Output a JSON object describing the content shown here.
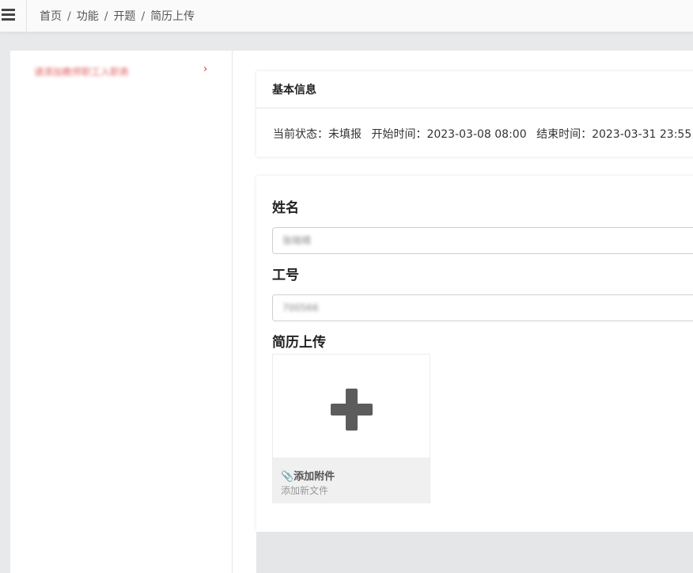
{
  "breadcrumb": {
    "items": [
      "首页",
      "功能",
      "开题",
      "简历上传"
    ],
    "separator": "/"
  },
  "sidebar": {
    "items": [
      {
        "label": "请添加教师职工入职表",
        "icon": "chevron-right-icon"
      }
    ]
  },
  "basic_info": {
    "title": "基本信息",
    "status_label": "当前状态：",
    "status_value": "未填报",
    "start_label": "开始时间：",
    "start_value": "2023-03-08 08:00",
    "end_label": "结束时间：",
    "end_value": "2023-03-31 23:55"
  },
  "form": {
    "name_label": "姓名",
    "name_value": "张晓晴",
    "id_label": "工号",
    "id_value": "700566",
    "resume_label": "简历上传",
    "upload_title": "📎添加附件",
    "upload_subtitle": "添加新文件"
  },
  "colors": {
    "accent_red": "#c9302c",
    "page_bg": "#e8e9eb"
  }
}
